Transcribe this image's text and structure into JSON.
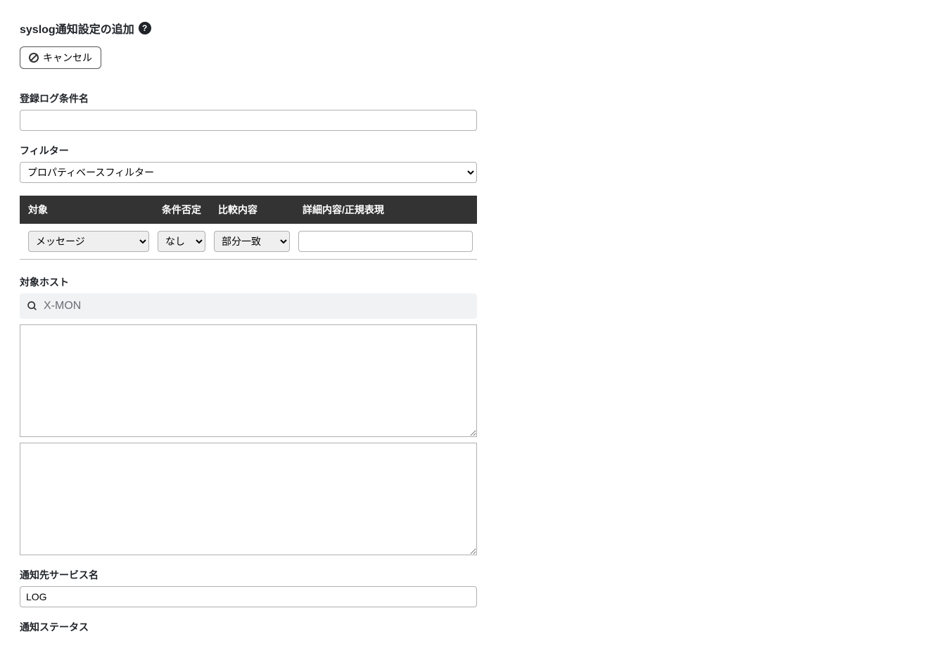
{
  "title": "syslog通知設定の追加",
  "cancel_label": "キャンセル",
  "fields": {
    "name_label": "登録ログ条件名",
    "name_value": "",
    "filter_label": "フィルター",
    "filter_value": "プロパティベースフィルター",
    "filter_options": [
      "プロパティベースフィルター"
    ],
    "table": {
      "headers": [
        "対象",
        "条件否定",
        "比較内容",
        "詳細内容/正規表現"
      ],
      "row": {
        "target_value": "メッセージ",
        "target_options": [
          "メッセージ"
        ],
        "negate_value": "なし",
        "negate_options": [
          "なし"
        ],
        "compare_value": "部分一致",
        "compare_options": [
          "部分一致"
        ],
        "detail_value": ""
      }
    },
    "hosts_label": "対象ホスト",
    "search_placeholder": "X-MON",
    "hosts_box1": "",
    "hosts_box2": "",
    "service_label": "通知先サービス名",
    "service_value": "LOG",
    "status_label": "通知ステータス"
  }
}
